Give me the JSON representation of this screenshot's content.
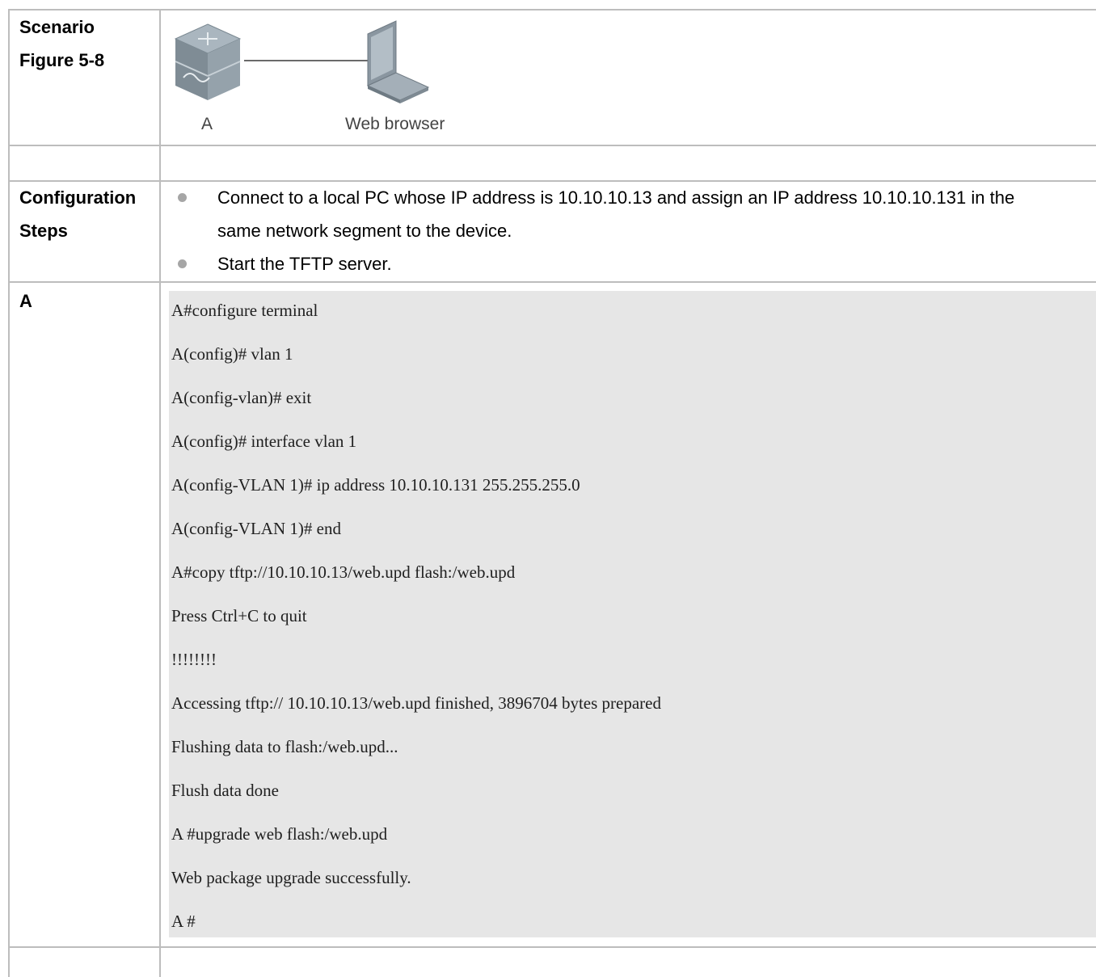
{
  "rows": {
    "scenario": {
      "label_line1": "Scenario",
      "label_line2": "Figure 5-8"
    },
    "steps": {
      "label_line1": "Configuration",
      "label_line2": "Steps",
      "items": [
        {
          "line1": "Connect to a local PC whose IP address is 10.10.10.13 and assign an IP address 10.10.10.131 in the",
          "line2": "same network segment to the device."
        },
        {
          "line1": "Start the TFTP server."
        }
      ]
    },
    "device": {
      "label": "A"
    }
  },
  "diagram": {
    "device_label": "A",
    "pc_label": "Web browser",
    "device_icon": "switch-icon",
    "pc_icon": "laptop-icon"
  },
  "code_lines": [
    "A#configure terminal",
    "A(config)# vlan 1",
    "A(config-vlan)# exit",
    "A(config)# interface vlan 1",
    "A(config-VLAN 1)# ip address 10.10.10.131 255.255.255.0",
    "A(config-VLAN 1)# end",
    "A#copy tftp://10.10.10.13/web.upd flash:/web.upd",
    "Press Ctrl+C to quit",
    "!!!!!!!!",
    "Accessing tftp:// 10.10.10.13/web.upd finished, 3896704 bytes prepared",
    "Flushing data to flash:/web.upd...",
    "Flush data done",
    "A #upgrade web flash:/web.upd",
    "Web package upgrade successfully.",
    "A #"
  ]
}
